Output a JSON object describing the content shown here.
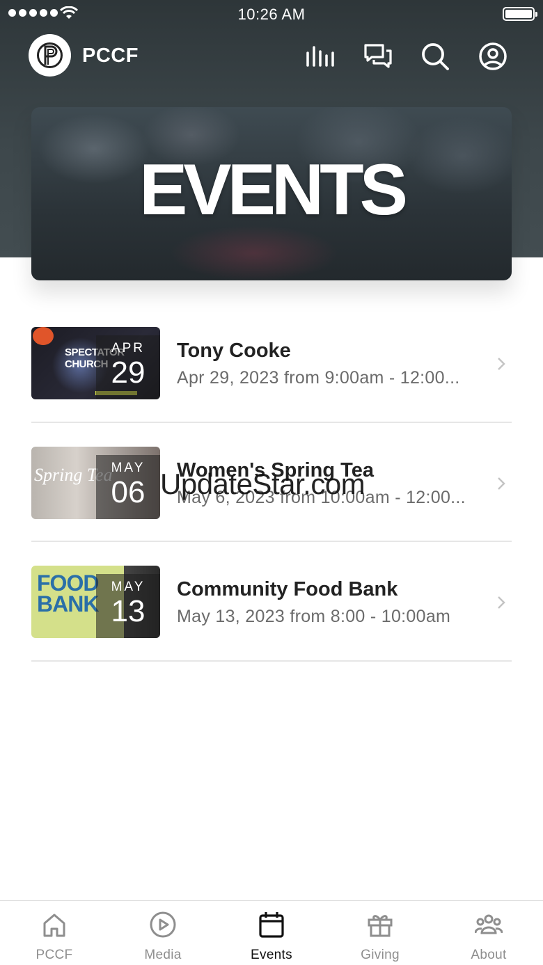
{
  "status_bar": {
    "time": "10:26 AM"
  },
  "header": {
    "app_name": "PCCF"
  },
  "hero": {
    "title": "EVENTS"
  },
  "events": [
    {
      "title": "Tony Cooke",
      "subtitle": "Apr 29, 2023 from 9:00am - 12:00...",
      "month": "APR",
      "day": "29",
      "thumb_text": "SPECTATOR CHURCH"
    },
    {
      "title": "Women's Spring Tea",
      "subtitle": "May 6, 2023 from 10:00am - 12:00...",
      "month": "MAY",
      "day": "06",
      "thumb_text": "Spring Tea"
    },
    {
      "title": "Community Food Bank",
      "subtitle": "May 13, 2023 from 8:00 - 10:00am",
      "month": "MAY",
      "day": "13",
      "thumb_text": "FOOD BANK"
    }
  ],
  "watermark": "UpdateStar.com",
  "tabs": [
    {
      "label": "PCCF",
      "icon": "home-icon"
    },
    {
      "label": "Media",
      "icon": "play-circle-icon"
    },
    {
      "label": "Events",
      "icon": "calendar-icon"
    },
    {
      "label": "Giving",
      "icon": "gift-icon"
    },
    {
      "label": "About",
      "icon": "group-icon"
    }
  ],
  "colors": {
    "header_bg": "#3d474b",
    "active_tab": "#111111",
    "inactive_tab": "#8e8e8e"
  }
}
